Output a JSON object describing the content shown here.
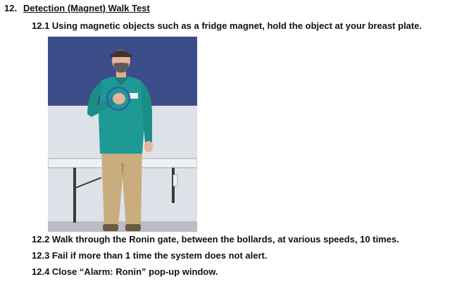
{
  "section": {
    "number": "12.",
    "title": "Detection (Magnet) Walk Test"
  },
  "steps": [
    "12.1 Using magnetic objects such as a fridge magnet, hold the object at your breast plate.",
    "12.2 Walk through the Ronin gate, between the bollards, at various speeds, 10 times.",
    "12.3 Fail if more than 1 time the system does not alert.",
    "12.4 Close “Alarm: Ronin” pop-up window."
  ],
  "colors": {
    "wall_blue": "#3d4d8a",
    "wall_grey": "#d9dde4",
    "shirt_teal": "#1e9a94",
    "pants_khaki": "#c9ad7c",
    "highlight_ring": "#2f5fb0"
  }
}
